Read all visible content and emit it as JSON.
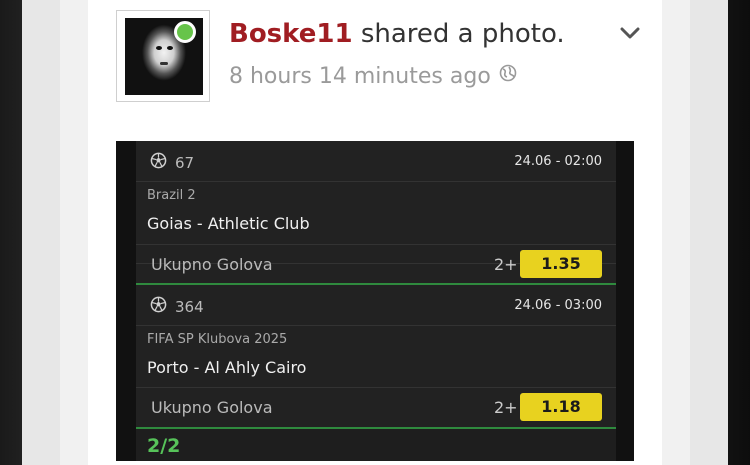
{
  "post": {
    "username": "Boske11",
    "action": "shared a photo.",
    "timestamp": "8 hours 14 minutes ago",
    "username_color": "#a01d22",
    "online_color": "#67c44a"
  },
  "ticket": {
    "bets": [
      {
        "number": "67",
        "datetime": "24.06  -  02:00",
        "league": "Brazil 2",
        "match": "Goias - Athletic Club",
        "market": "Ukupno Golova",
        "selection": "2+",
        "odds": "1.35"
      },
      {
        "number": "364",
        "datetime": "24.06  -  03:00",
        "league": "FIFA SP Klubova 2025",
        "match": "Porto - Al Ahly Cairo",
        "market": "Ukupno Golova",
        "selection": "2+",
        "odds": "1.18"
      }
    ],
    "count": "2/2",
    "odds_color": "#e8d21f",
    "count_color": "#57c35a"
  }
}
